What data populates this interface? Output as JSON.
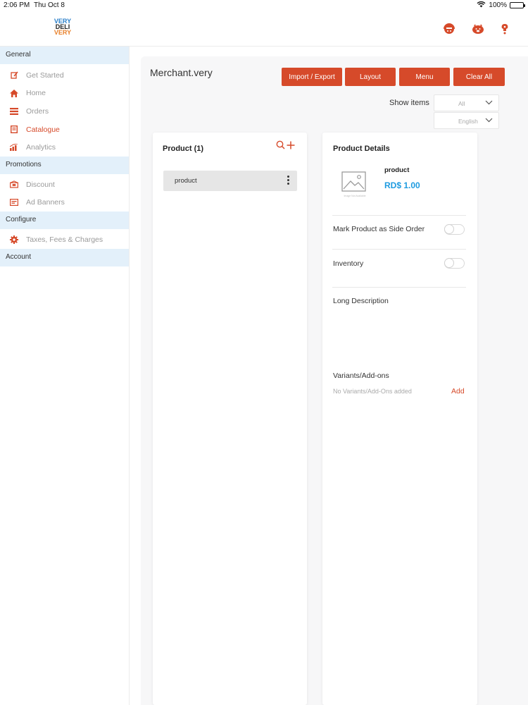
{
  "status": {
    "time": "2:06 PM",
    "date": "Thu Oct 8",
    "battery": "100%"
  },
  "logo": {
    "line1": "VERY",
    "line2": "DELI",
    "line3": "VERY"
  },
  "header_icons": [
    "support-agent-icon",
    "pig-icon",
    "notification-icon"
  ],
  "sidebar": {
    "sections": [
      {
        "title": "General",
        "items": [
          {
            "label": "Get Started",
            "icon": "edit-icon",
            "active": false
          },
          {
            "label": "Home",
            "icon": "home-icon",
            "active": false
          },
          {
            "label": "Orders",
            "icon": "orders-icon",
            "active": false
          },
          {
            "label": "Catalogue",
            "icon": "catalogue-icon",
            "active": true
          },
          {
            "label": "Analytics",
            "icon": "analytics-icon",
            "active": false
          }
        ]
      },
      {
        "title": "Promotions",
        "items": [
          {
            "label": "Discount",
            "icon": "discount-icon",
            "active": false
          },
          {
            "label": "Ad Banners",
            "icon": "banner-icon",
            "active": false
          }
        ]
      },
      {
        "title": "Configure",
        "items": [
          {
            "label": "Taxes, Fees & Charges",
            "icon": "settings-gear-icon",
            "active": false
          }
        ]
      },
      {
        "title": "Account",
        "items": []
      }
    ]
  },
  "main": {
    "merchant": "Merchant.very",
    "buttons": {
      "import_export": "Import / Export",
      "layout": "Layout",
      "menu": "Menu",
      "clear_all": "Clear All"
    },
    "show_items_label": "Show items",
    "filter_select": "All",
    "language_select": "English"
  },
  "product_panel": {
    "title": "Product (1)",
    "items": [
      {
        "name": "product"
      }
    ]
  },
  "details": {
    "title": "Product Details",
    "image_caption": "Image Not Available",
    "product_name": "product",
    "price": "RD$ 1.00",
    "side_order_label": "Mark Product as Side Order",
    "side_order_on": false,
    "inventory_label": "Inventory",
    "inventory_on": false,
    "long_description_label": "Long Description",
    "variants_label": "Variants/Add-ons",
    "variants_empty": "No Variants/Add-Ons added",
    "add_label": "Add"
  },
  "colors": {
    "accent": "#d64a2a",
    "section_bg": "#e3f0fa",
    "price": "#1e9be0"
  }
}
